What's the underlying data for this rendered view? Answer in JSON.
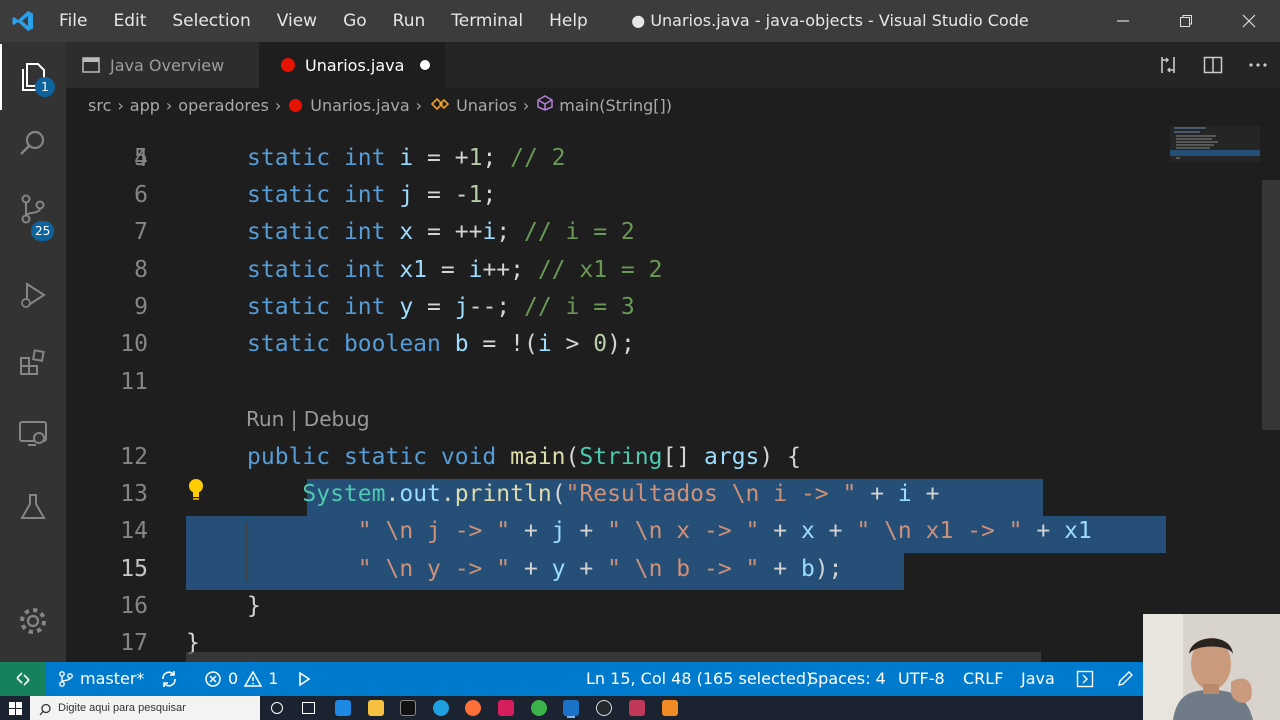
{
  "window": {
    "title": "● Unarios.java - java-objects - Visual Studio Code",
    "menu": [
      "File",
      "Edit",
      "Selection",
      "View",
      "Go",
      "Run",
      "Terminal",
      "Help"
    ]
  },
  "activity_bar": {
    "explorer_badge": "1",
    "scm_badge": "25"
  },
  "tabs": [
    {
      "label": "Java Overview",
      "active": false,
      "icon": "preview-icon"
    },
    {
      "label": "Unarios.java",
      "active": true,
      "icon": "java-error-icon",
      "dirty": true
    }
  ],
  "breadcrumb": {
    "items": [
      "src",
      "app",
      "operadores",
      "Unarios.java",
      "Unarios",
      "main(String[])"
    ]
  },
  "editor": {
    "codelens": "Run | Debug",
    "partial_line_number": "4",
    "lines": [
      {
        "n": "5",
        "segs": [
          [
            "kw",
            "static "
          ],
          [
            "kw",
            "int "
          ],
          [
            "vr",
            "i"
          ],
          [
            "op",
            " = +"
          ],
          [
            "nm",
            "1"
          ],
          [
            "op",
            "; "
          ],
          [
            "cm",
            "// 2"
          ]
        ]
      },
      {
        "n": "6",
        "segs": [
          [
            "kw",
            "static "
          ],
          [
            "kw",
            "int "
          ],
          [
            "vr",
            "j"
          ],
          [
            "op",
            " = -"
          ],
          [
            "nm",
            "1"
          ],
          [
            "op",
            ";"
          ]
        ]
      },
      {
        "n": "7",
        "segs": [
          [
            "kw",
            "static "
          ],
          [
            "kw",
            "int "
          ],
          [
            "vr",
            "x"
          ],
          [
            "op",
            " = ++"
          ],
          [
            "vr",
            "i"
          ],
          [
            "op",
            "; "
          ],
          [
            "cm",
            "// i = 2"
          ]
        ]
      },
      {
        "n": "8",
        "segs": [
          [
            "kw",
            "static "
          ],
          [
            "kw",
            "int "
          ],
          [
            "vr",
            "x1"
          ],
          [
            "op",
            " = "
          ],
          [
            "vr",
            "i"
          ],
          [
            "op",
            "++; "
          ],
          [
            "cm",
            "// x1 = 2"
          ]
        ]
      },
      {
        "n": "9",
        "segs": [
          [
            "kw",
            "static "
          ],
          [
            "kw",
            "int "
          ],
          [
            "vr",
            "y"
          ],
          [
            "op",
            " = "
          ],
          [
            "vr",
            "j"
          ],
          [
            "op",
            "--; "
          ],
          [
            "cm",
            "// i = 3"
          ]
        ]
      },
      {
        "n": "10",
        "segs": [
          [
            "kw",
            "static "
          ],
          [
            "kw",
            "boolean "
          ],
          [
            "vr",
            "b"
          ],
          [
            "op",
            " = !("
          ],
          [
            "vr",
            "i"
          ],
          [
            "op",
            " > "
          ],
          [
            "nm",
            "0"
          ],
          [
            "op",
            ");"
          ]
        ]
      },
      {
        "n": "11",
        "segs": []
      },
      {
        "n": "12",
        "segs": [
          [
            "kw",
            "public "
          ],
          [
            "kw",
            "static "
          ],
          [
            "kw",
            "void "
          ],
          [
            "fn",
            "main"
          ],
          [
            "op",
            "("
          ],
          [
            "tp",
            "String"
          ],
          [
            "op",
            "[] "
          ],
          [
            "vr",
            "args"
          ],
          [
            "op",
            ") {"
          ]
        ]
      },
      {
        "n": "13",
        "segs": [
          [
            "op",
            "    "
          ],
          [
            "tp",
            "System"
          ],
          [
            "op",
            "."
          ],
          [
            "vr",
            "out"
          ],
          [
            "op",
            "."
          ],
          [
            "fn",
            "println"
          ],
          [
            "op",
            "("
          ],
          [
            "str",
            "\"Resultados \\n i -> \""
          ],
          [
            "op",
            " + "
          ],
          [
            "vr",
            "i"
          ],
          [
            "op",
            " +"
          ]
        ]
      },
      {
        "n": "14",
        "segs": [
          [
            "op",
            "        "
          ],
          [
            "str",
            "\" \\n j -> \""
          ],
          [
            "op",
            " + "
          ],
          [
            "vr",
            "j"
          ],
          [
            "op",
            " + "
          ],
          [
            "str",
            "\" \\n x -> \""
          ],
          [
            "op",
            " + "
          ],
          [
            "vr",
            "x"
          ],
          [
            "op",
            " + "
          ],
          [
            "str",
            "\" \\n x1 -> \""
          ],
          [
            "op",
            " + "
          ],
          [
            "vr",
            "x1"
          ]
        ]
      },
      {
        "n": "15",
        "segs": [
          [
            "op",
            "        "
          ],
          [
            "str",
            "\" \\n y -> \""
          ],
          [
            "op",
            " + "
          ],
          [
            "vr",
            "y"
          ],
          [
            "op",
            " + "
          ],
          [
            "str",
            "\" \\n b -> \""
          ],
          [
            "op",
            " + "
          ],
          [
            "vr",
            "b"
          ],
          [
            "op",
            ");"
          ]
        ]
      },
      {
        "n": "16",
        "segs": [
          [
            "op",
            "}"
          ]
        ]
      },
      {
        "n": "17",
        "segs": [
          [
            "op",
            "}"
          ]
        ]
      }
    ]
  },
  "status_bar": {
    "branch": "master*",
    "errors": "0",
    "warnings": "1",
    "cursor": "Ln 15, Col 48 (165 selected)",
    "spaces": "Spaces: 4",
    "encoding": "UTF-8",
    "eol": "CRLF",
    "language": "Java"
  },
  "taskbar": {
    "search_placeholder": "Digite aqui para pesquisar"
  }
}
